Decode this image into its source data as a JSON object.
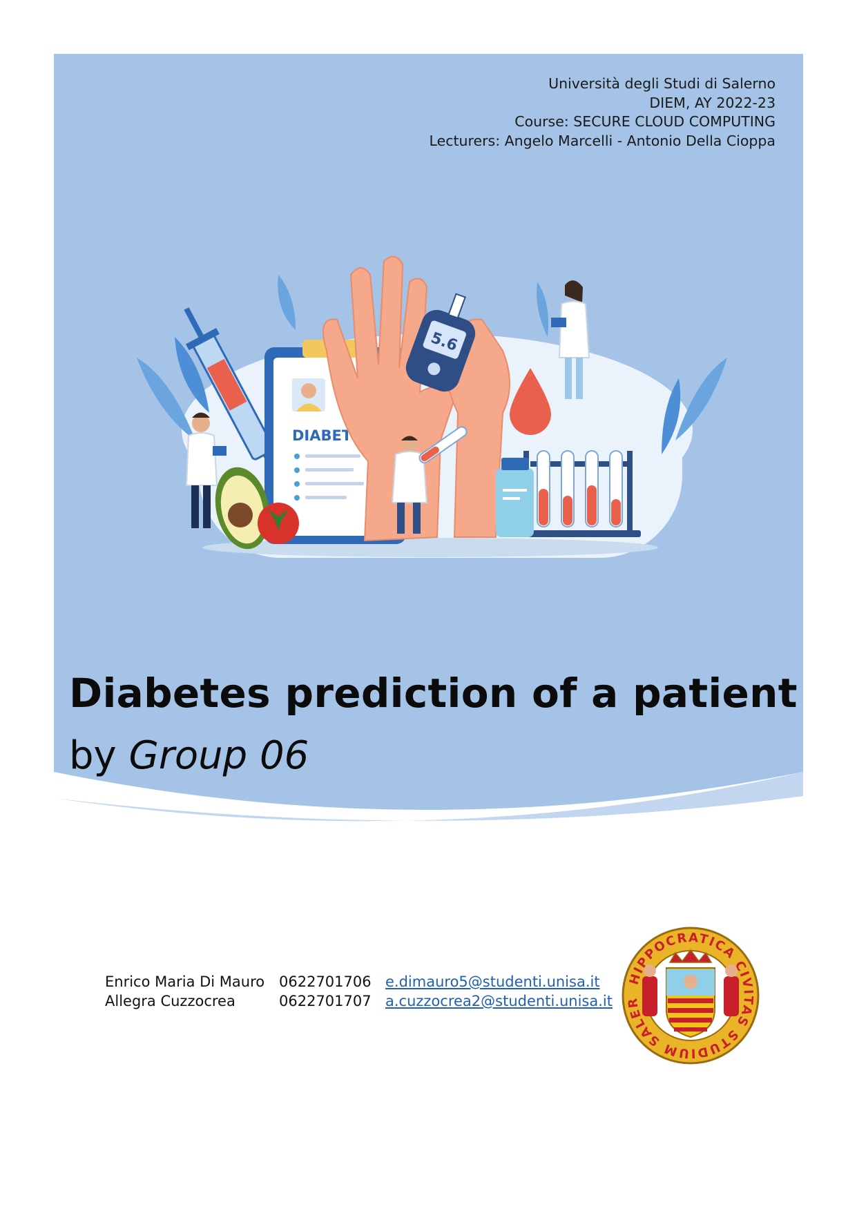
{
  "header": {
    "university": "Università degli Studi di Salerno",
    "department": "DIEM, AY 2022-23",
    "course": "Course: SECURE CLOUD COMPUTING",
    "lecturers": "Lecturers: Angelo Marcelli - Antonio Della Cioppa"
  },
  "illustration": {
    "clipboard_label": "DIABETES",
    "glucometer_reading": "5.6"
  },
  "title": "Diabetes prediction of a patient",
  "subtitle": {
    "prefix": "by ",
    "group": "Group 06"
  },
  "authors": [
    {
      "name": "Enrico Maria Di Mauro",
      "id": "0622701706",
      "email": "e.dimauro5@studenti.unisa.it"
    },
    {
      "name": "Allegra Cuzzocrea",
      "id": "0622701707",
      "email": "a.cuzzocrea2@studenti.unisa.it"
    }
  ],
  "seal": {
    "text": "HIPPOCRATICA CIVITAS STUDIUM SALERNI"
  },
  "colors": {
    "cover_blue": "#a4c3e6",
    "cover_wave": "#c2d7ef",
    "link": "#1f5fb4",
    "seal_gold": "#e9b428",
    "seal_red": "#c8202b"
  }
}
